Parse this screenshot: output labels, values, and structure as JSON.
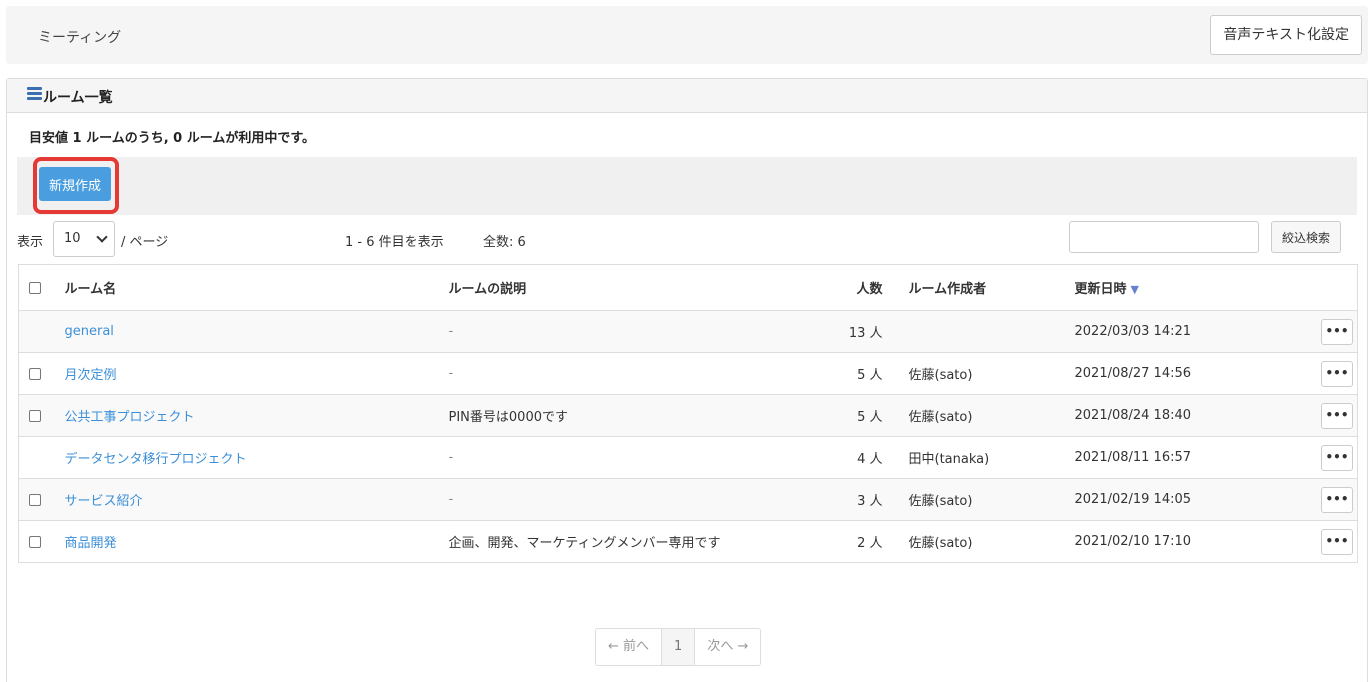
{
  "topbar": {
    "title": "ミーティング",
    "settings_label": "音声テキスト化設定"
  },
  "panel": {
    "title": "ルーム一覧",
    "notice": "目安値 1 ルームのうち, 0 ルームが利用中です。"
  },
  "toolbar": {
    "new_label": "新規作成"
  },
  "controls": {
    "show_label": "表示",
    "per_page": "10",
    "page_label": "/ ページ",
    "range_text": "1 - 6 件目を表示",
    "total_text": "全数: 6",
    "search_placeholder": "",
    "search_button": "絞込検索"
  },
  "table": {
    "headers": {
      "name": "ルーム名",
      "desc": "ルームの説明",
      "count": "人数",
      "owner": "ルーム作成者",
      "date": "更新日時"
    },
    "sort_icon": "▼",
    "rows": [
      {
        "checkbox": false,
        "name": "general",
        "desc": "-",
        "count": "13 人",
        "owner": "",
        "date": "2022/03/03 14:21"
      },
      {
        "checkbox": true,
        "name": "月次定例",
        "desc": "-",
        "count": "5 人",
        "owner": "佐藤(sato)",
        "date": "2021/08/27 14:56"
      },
      {
        "checkbox": true,
        "name": "公共工事プロジェクト",
        "desc": "PIN番号は0000です",
        "count": "5 人",
        "owner": "佐藤(sato)",
        "date": "2021/08/24 18:40"
      },
      {
        "checkbox": false,
        "name": "データセンタ移行プロジェクト",
        "desc": "-",
        "count": "4 人",
        "owner": "田中(tanaka)",
        "date": "2021/08/11 16:57"
      },
      {
        "checkbox": true,
        "name": "サービス紹介",
        "desc": "-",
        "count": "3 人",
        "owner": "佐藤(sato)",
        "date": "2021/02/19 14:05"
      },
      {
        "checkbox": true,
        "name": "商品開発",
        "desc": "企画、開発、マーケティングメンバー専用です",
        "count": "2 人",
        "owner": "佐藤(sato)",
        "date": "2021/02/10 17:10"
      }
    ],
    "menu_glyph": "•••"
  },
  "pager": {
    "prev": "← 前へ",
    "current": "1",
    "next": "次へ →"
  }
}
